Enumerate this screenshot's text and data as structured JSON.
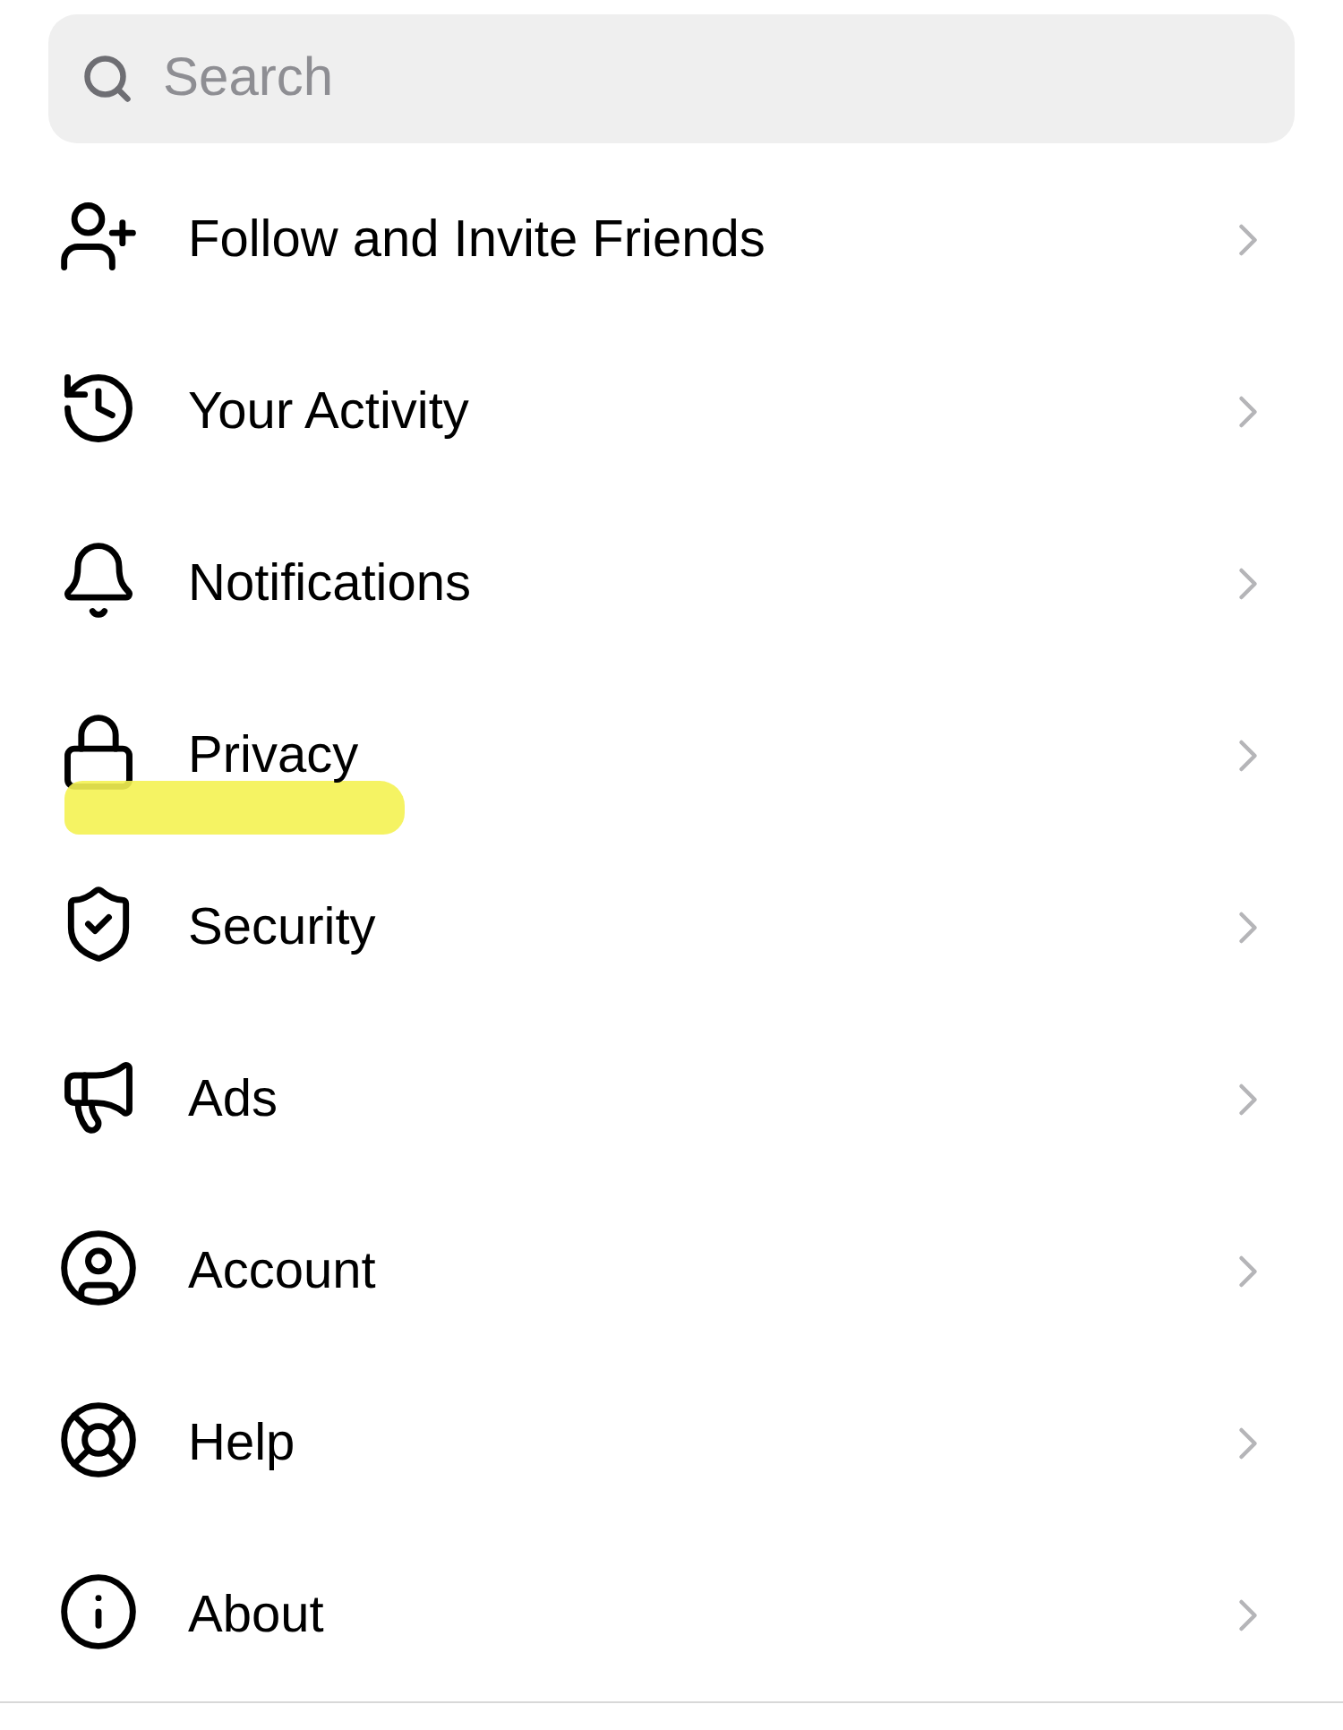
{
  "search": {
    "placeholder": "Search"
  },
  "items": [
    {
      "label": "Follow and Invite Friends",
      "highlighted": false
    },
    {
      "label": "Your Activity",
      "highlighted": false
    },
    {
      "label": "Notifications",
      "highlighted": false
    },
    {
      "label": "Privacy",
      "highlighted": true
    },
    {
      "label": "Security",
      "highlighted": false
    },
    {
      "label": "Ads",
      "highlighted": false
    },
    {
      "label": "Account",
      "highlighted": false
    },
    {
      "label": "Help",
      "highlighted": false
    },
    {
      "label": "About",
      "highlighted": false
    }
  ]
}
